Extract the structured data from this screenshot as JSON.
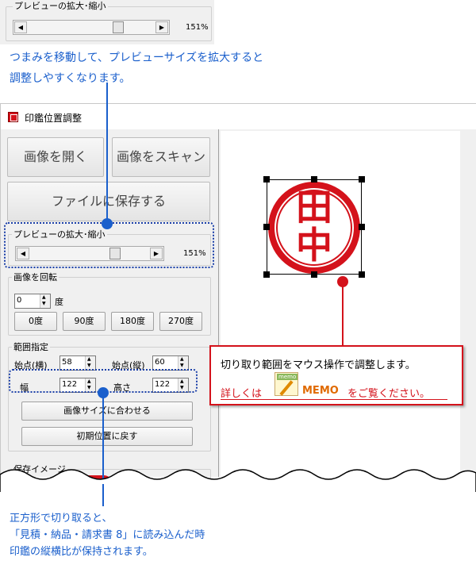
{
  "top_panel": {
    "legend": "プレビューの拡大･縮小",
    "zoom_value": "151%"
  },
  "callouts": {
    "top_line1": "つまみを移動して、プレビューサイズを拡大すると",
    "top_line2": "調整しやすくなります。",
    "right_line1": "切り取り範囲をマウス操作で調整します。",
    "right_prefix": "詳しくは",
    "memo_icon_text": "memo",
    "memo_label": "MEMO",
    "right_suffix": "をご覧ください。",
    "bottom_line1": "正方形で切り取ると、",
    "bottom_line2": "「見積・納品・請求書 8」に読み込んだ時",
    "bottom_line3": "印鑑の縦横比が保持されます。"
  },
  "window": {
    "title": "印鑑位置調整",
    "open_image": "画像を開く",
    "scan_image": "画像をスキャン",
    "save_file": "ファイルに保存する",
    "preview_zoom_legend": "プレビューの拡大･縮小",
    "preview_zoom_value": "151%",
    "rotate_legend": "画像を回転",
    "rotate_value": "0",
    "rotate_unit": "度",
    "rotate_buttons": [
      "0度",
      "90度",
      "180度",
      "270度"
    ],
    "range_legend": "範囲指定",
    "start_x_label": "始点(横)",
    "start_x_value": "58",
    "start_y_label": "始点(縦)",
    "start_y_value": "60",
    "width_label": "幅",
    "width_value": "122",
    "height_label": "高さ",
    "height_value": "122",
    "fit_button": "画像サイズに合わせる",
    "reset_button": "初期位置に戻す",
    "save_image_legend": "保存イメージ",
    "stamp_chars": [
      "田",
      "中"
    ]
  },
  "zoom_level": 0.72,
  "colors": {
    "callout_blue": "#1a5fcc",
    "stamp_red": "#d4121b",
    "memo_orange": "#e06a00"
  }
}
